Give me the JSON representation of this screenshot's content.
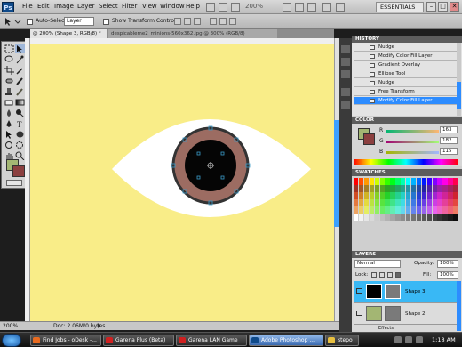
{
  "menu": {
    "logo": "Ps",
    "items": [
      "File",
      "Edit",
      "Image",
      "Layer",
      "Select",
      "Filter",
      "View",
      "Window",
      "Help"
    ],
    "zoom": "200%",
    "workspace": "ESSENTIALS",
    "win_minimize": "–",
    "win_restore": "□",
    "win_close": "✕"
  },
  "options": {
    "auto_select_label": "Auto-Select:",
    "auto_select_value": "Layer",
    "show_transform_label": "Show Transform Controls"
  },
  "tabs": [
    {
      "label": "@ 200% (Shape 3, RGB/8) *"
    },
    {
      "label": "despicableme2_minions-560x362.jpg @ 300% (RGB/8)"
    }
  ],
  "status": {
    "zoom": "200%",
    "doc": "Doc: 2.06M/0 bytes"
  },
  "history": {
    "title": "HISTORY",
    "items": [
      "Nudge",
      "Modify Color Fill Layer",
      "Gradient Overlay",
      "Ellipse Tool",
      "Nudge",
      "Free Transform",
      "Modify Color Fill Layer"
    ]
  },
  "color": {
    "title": "COLOR",
    "channels": [
      {
        "label": "R",
        "value": "163"
      },
      {
        "label": "G",
        "value": "182"
      },
      {
        "label": "B",
        "value": "115"
      }
    ]
  },
  "swatches": {
    "title": "SWATCHES"
  },
  "layers": {
    "title": "LAYERS",
    "blend_mode": "Normal",
    "opacity_label": "Opacity:",
    "opacity_value": "100%",
    "lock_label": "Lock:",
    "fill_label": "Fill:",
    "fill_value": "100%",
    "rows": [
      {
        "name": "Shape 3"
      },
      {
        "name": "Shape 2"
      }
    ],
    "effects_label": "Effects"
  },
  "taskbar": {
    "tasks": [
      "Find Jobs - oDesk -...",
      "Garena Plus (Beta)",
      "Garena LAN Game",
      "Adobe Photoshop ...",
      "stepo"
    ],
    "clock": "1:18 AM"
  },
  "colors": {
    "canvas_bg": "#f9ed88",
    "eye_white": "#ffffff",
    "iris": "#9c6c62",
    "selection_blue": "#2d8cff",
    "foreground": "#a3b673",
    "background": "#8b3f3f"
  }
}
